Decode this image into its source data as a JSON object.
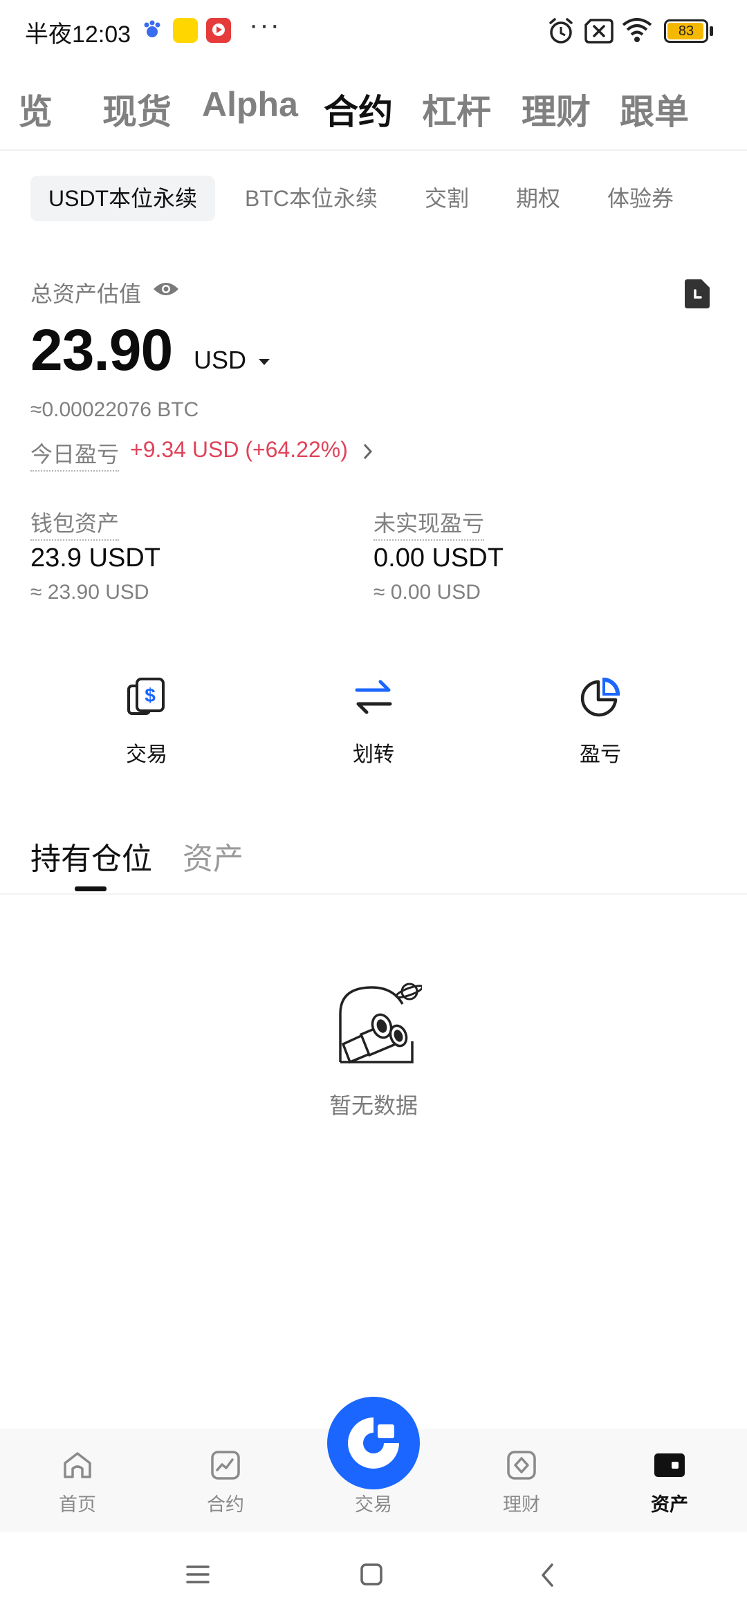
{
  "status_bar": {
    "time": "半夜12:03",
    "more": "···",
    "battery": "83",
    "icons": [
      "baidu-app-icon",
      "app-icon-yellow",
      "app-icon-red",
      "alarm-icon",
      "sim-off-icon",
      "wifi-icon",
      "battery-icon"
    ]
  },
  "top_tabs": [
    {
      "label": "览"
    },
    {
      "label": "现货"
    },
    {
      "label": "Alpha"
    },
    {
      "label": "合约",
      "active": true
    },
    {
      "label": "杠杆"
    },
    {
      "label": "理财"
    },
    {
      "label": "跟单"
    }
  ],
  "sub_tabs": [
    {
      "label": "USDT本位永续",
      "active": true
    },
    {
      "label": "BTC本位永续"
    },
    {
      "label": "交割"
    },
    {
      "label": "期权"
    },
    {
      "label": "体验券"
    }
  ],
  "assets": {
    "total_label": "总资产估值",
    "total_value": "23.90",
    "currency": "USD",
    "btc_equiv": "≈0.00022076 BTC",
    "pnl_label": "今日盈亏",
    "pnl_value": "+9.34 USD (+64.22%)",
    "wallet_label": "钱包资产",
    "wallet_value": "23.9 USDT",
    "wallet_usd": "≈ 23.90 USD",
    "unrealized_label": "未实现盈亏",
    "unrealized_value": "0.00 USDT",
    "unrealized_usd": "≈ 0.00 USD"
  },
  "actions": [
    {
      "label": "交易",
      "icon": "dollar-card-icon"
    },
    {
      "label": "划转",
      "icon": "transfer-arrows-icon"
    },
    {
      "label": "盈亏",
      "icon": "pie-chart-icon"
    }
  ],
  "position_tabs": [
    {
      "label": "持有仓位",
      "active": true
    },
    {
      "label": "资产"
    }
  ],
  "empty": {
    "text": "暂无数据",
    "icon": "binoculars-icon"
  },
  "bottom_nav": [
    {
      "label": "首页",
      "icon": "home-icon"
    },
    {
      "label": "合约",
      "icon": "chart-icon"
    },
    {
      "label": "交易",
      "icon": "trade-logo-icon"
    },
    {
      "label": "理财",
      "icon": "finance-icon"
    },
    {
      "label": "资产",
      "icon": "wallet-icon",
      "active": true
    }
  ],
  "colors": {
    "accent": "#1a66ff",
    "positive_pnl": "#e0435a",
    "muted": "#808080"
  }
}
